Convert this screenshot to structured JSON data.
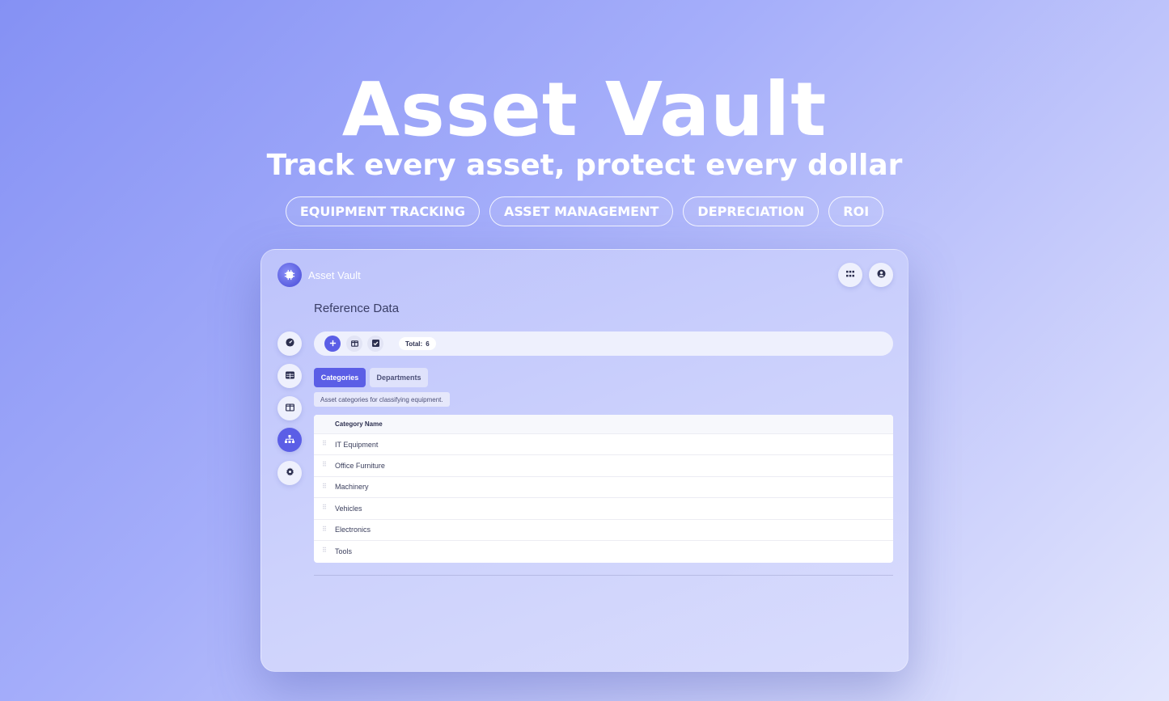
{
  "hero": {
    "title": "Asset Vault",
    "subtitle": "Track every asset, protect every dollar",
    "tags": [
      "EQUIPMENT TRACKING",
      "ASSET MANAGEMENT",
      "DEPRECIATION",
      "ROI"
    ]
  },
  "app": {
    "name": "Asset Vault",
    "logo_icon": "chip-icon",
    "top_actions": [
      {
        "icon": "grid-icon"
      },
      {
        "icon": "user-circle-icon"
      }
    ],
    "sidebar": [
      {
        "icon": "dashboard-icon",
        "active": false
      },
      {
        "icon": "table-icon",
        "active": false
      },
      {
        "icon": "columns-icon",
        "active": false
      },
      {
        "icon": "hierarchy-icon",
        "active": true
      },
      {
        "icon": "gear-icon",
        "active": false
      }
    ],
    "page_title": "Reference Data",
    "toolbar": {
      "buttons": [
        {
          "icon": "plus-icon"
        },
        {
          "icon": "columns-icon"
        },
        {
          "icon": "checkbox-icon"
        }
      ],
      "total_label": "Total:",
      "total_value": "6"
    },
    "tabs": [
      {
        "label": "Categories",
        "active": true
      },
      {
        "label": "Departments",
        "active": false
      }
    ],
    "hint": "Asset categories for classifying equipment.",
    "table": {
      "column": "Category Name",
      "rows": [
        "IT Equipment",
        "Office Furniture",
        "Machinery",
        "Vehicles",
        "Electronics",
        "Tools"
      ]
    }
  },
  "colors": {
    "accent": "#5b5ee6",
    "background_start": "#8591f4",
    "background_end": "#e3e6fd"
  }
}
